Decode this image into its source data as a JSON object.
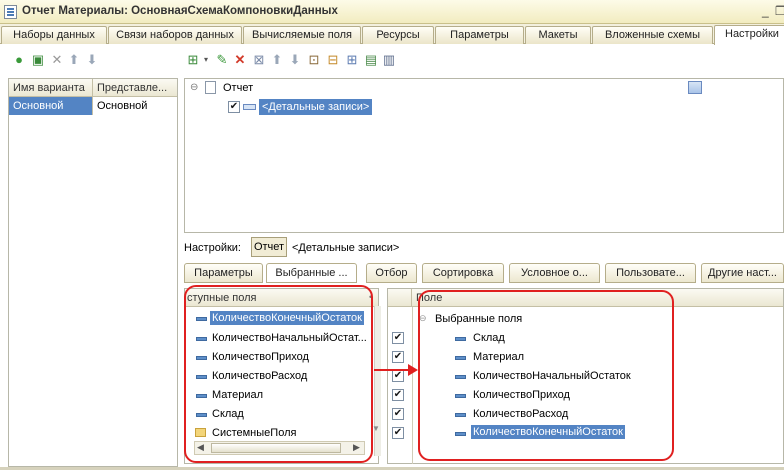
{
  "window": {
    "title": "Отчет Материалы: ОсновнаяСхемаКомпоновкиДанных",
    "minimize": "_",
    "restore": "❐"
  },
  "tabs": [
    "Наборы данных",
    "Связи наборов данных",
    "Вычисляемые поля",
    "Ресурсы",
    "Параметры",
    "Макеты",
    "Вложенные схемы",
    "Настройки"
  ],
  "variants": {
    "columns": [
      "Имя варианта",
      "Представле..."
    ],
    "rows": [
      [
        "Основной",
        "Основной"
      ]
    ]
  },
  "structure": {
    "root": "Отчет",
    "child": "<Детальные записи>"
  },
  "settings": {
    "label": "Настройки:",
    "button": "Отчет",
    "context": "<Детальные записи>",
    "tabs": [
      "Параметры",
      "Выбранные ...",
      "Отбор",
      "Сортировка",
      "Условное о...",
      "Пользовате...",
      "Другие наст..."
    ]
  },
  "available": {
    "header": "ступные поля",
    "items": [
      "КоличествоКонечныйОстаток",
      "КоличествоНачальныйОстат...",
      "КоличествоПриход",
      "КоличествоРасход",
      "Материал",
      "Склад",
      "СистемныеПоля"
    ]
  },
  "selected": {
    "header": "Поле",
    "group": "Выбранные поля",
    "items": [
      "Склад",
      "Материал",
      "КоличествоНачальныйОстаток",
      "КоличествоПриход",
      "КоличествоРасход",
      "КоличествоКонечныйОстаток"
    ]
  },
  "colors": {
    "selection": "#5384c4",
    "highlight": "#e02020",
    "chrome": "#f3f0de"
  }
}
